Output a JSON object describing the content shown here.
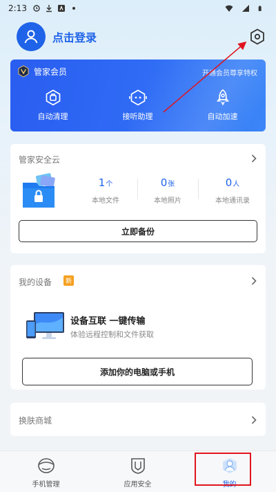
{
  "status_bar": {
    "time": "2:13",
    "icons": [
      "alarm-icon",
      "download-icon",
      "app-icon",
      "dot-icon"
    ],
    "right_icons": [
      "wifi-icon",
      "signal-icon",
      "battery-icon"
    ]
  },
  "header": {
    "login_label": "点击登录",
    "avatar_icon": "user-icon",
    "settings_icon": "gear-icon"
  },
  "vip": {
    "title": "管家会员",
    "promo_link": "开通会员尊享特权",
    "features": [
      {
        "label": "自动清理",
        "icon": "broom-icon"
      },
      {
        "label": "接听助理",
        "icon": "robot-icon"
      },
      {
        "label": "自动加速",
        "icon": "rocket-icon"
      }
    ]
  },
  "cloud": {
    "title": "管家安全云",
    "stats": [
      {
        "value": "1",
        "unit": "个",
        "label": "本地文件"
      },
      {
        "value": "0",
        "unit": "张",
        "label": "本地照片"
      },
      {
        "value": "0",
        "unit": "人",
        "label": "本地通讯录"
      }
    ],
    "backup_button": "立即备份"
  },
  "device": {
    "title": "我的设备",
    "badge": "新",
    "headline": "设备互联 一键传输",
    "subtitle": "体验远程控制和文件获取",
    "add_button": "添加你的电脑或手机"
  },
  "skin": {
    "title": "换肤商城"
  },
  "tabs": [
    {
      "label": "手机管理",
      "icon": "phone-manager-icon",
      "active": false
    },
    {
      "label": "应用安全",
      "icon": "shield-icon",
      "active": false
    },
    {
      "label": "我的",
      "icon": "profile-icon",
      "active": true
    }
  ],
  "colors": {
    "accent": "#1f63e8",
    "annotation": "#e0141e",
    "badge": "#f5a021"
  }
}
